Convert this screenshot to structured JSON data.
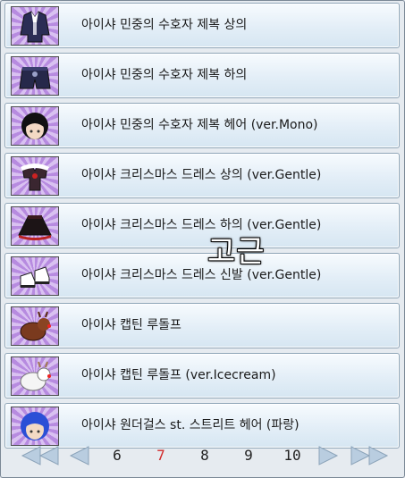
{
  "items": [
    {
      "label": "아이샤 민중의 수호자 제복 상의",
      "icon": "police-uniform-top-icon"
    },
    {
      "label": "아이샤 민중의 수호자 제복 하의",
      "icon": "police-uniform-bottom-icon"
    },
    {
      "label": "아이샤 민중의 수호자 제복 헤어 (ver.Mono)",
      "icon": "black-hair-icon"
    },
    {
      "label": "아이샤 크리스마스 드레스 상의 (ver.Gentle)",
      "icon": "christmas-dress-top-icon"
    },
    {
      "label": "아이샤 크리스마스 드레스 하의 (ver.Gentle)",
      "icon": "christmas-dress-skirt-icon"
    },
    {
      "label": "아이샤 크리스마스 드레스 신발 (ver.Gentle)",
      "icon": "christmas-shoes-icon"
    },
    {
      "label": "아이샤 캡틴 루돌프",
      "icon": "reindeer-icon"
    },
    {
      "label": "아이샤 캡틴 루돌프 (ver.Icecream)",
      "icon": "white-reindeer-icon"
    },
    {
      "label": "아이샤 원더걸스 st. 스트리트 헤어 (파랑)",
      "icon": "blue-hair-icon"
    }
  ],
  "pagination": {
    "pages": [
      "6",
      "7",
      "8",
      "9",
      "10"
    ],
    "current": "7"
  },
  "overlay_text": "고근"
}
